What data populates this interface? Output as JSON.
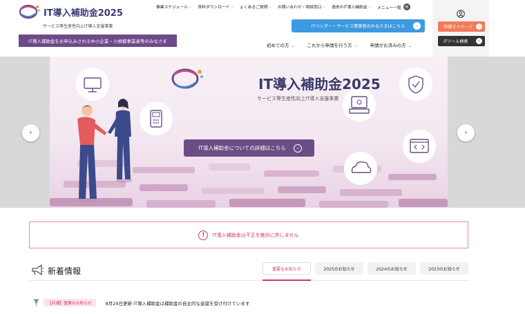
{
  "header": {
    "logo_title": "IT導入補助金2025",
    "logo_subtitle": "サービス等生産性向上IT導入支援事業",
    "target_banner": "IT導入補助金をお申込みされる中小企業・小規模事業者等のみなさま",
    "top_nav": [
      {
        "label": "事業スケジュール"
      },
      {
        "label": "資料ダウンロード"
      },
      {
        "label": "よくあるご質問"
      },
      {
        "label": "お問い合わせ・相談窓口"
      },
      {
        "label": "過去のIT導入補助金"
      }
    ],
    "menu_label": "メニュー一覧",
    "vendor_button": "ITベンダー・サービス事業者のみなさまはこちら",
    "sub_nav": [
      {
        "label": "初めての方"
      },
      {
        "label": "これから申請を行う方"
      },
      {
        "label": "申請がお済みの方"
      }
    ],
    "mypage_button": "申請マイページ",
    "tool_search_button": "ITツール検索"
  },
  "hero": {
    "title": "IT導入補助金2025",
    "subtitle": "サービス等生産性向上IT導入支援事業",
    "cta": "IT導入補助金についての詳細はこちら"
  },
  "notice": {
    "text": "IT導入補助金は不正を絶対に許しません"
  },
  "news": {
    "heading": "新着情報",
    "tabs": [
      {
        "label": "重要なお知らせ",
        "active": true
      },
      {
        "label": "2025のお知らせ",
        "active": false
      },
      {
        "label": "2024のお知らせ",
        "active": false
      },
      {
        "label": "2023のお知らせ",
        "active": false
      }
    ],
    "items": [
      {
        "tag": "【共通】重要なお知らせ",
        "text": "8月29日更新 IT導入補助金は補助金の自主的な返還を受け付けています"
      }
    ]
  },
  "colors": {
    "brand_purple": "#6e4a8a",
    "vendor_blue": "#3d9ae0",
    "mypage_orange": "#f27b57",
    "alert_pink": "#d6336c"
  }
}
